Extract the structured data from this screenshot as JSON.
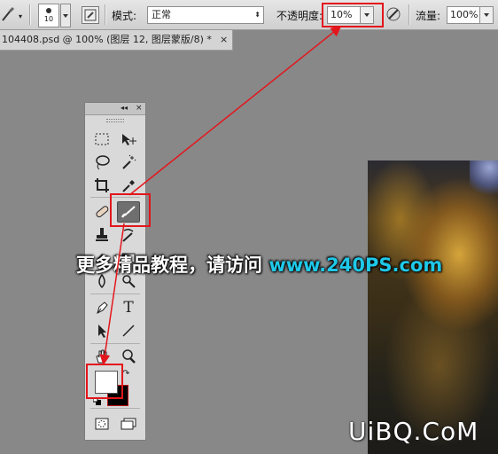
{
  "options_bar": {
    "brush_size": "10",
    "mode_label": "模式:",
    "mode_value": "正常",
    "opacity_label": "不透明度:",
    "opacity_value": "10%",
    "flow_label": "流量:",
    "flow_value": "100%"
  },
  "document_tab": {
    "title": "104408.psd @ 100% (图层 12, 图层蒙版/8) *",
    "close_label": "×"
  },
  "tools_panel": {
    "collapse_label": "◂◂",
    "close_label": "×",
    "type_tool_glyph": "T",
    "active_tool": "brush-tool"
  },
  "colors": {
    "foreground": "#ffffff",
    "background": "#000000",
    "annotation": "#e3161c",
    "banner_url": "#1fc8e8"
  },
  "banner": {
    "text": "更多精品教程，请访问",
    "url": "www.240PS.com"
  },
  "watermark": "UiBQ.CoM"
}
